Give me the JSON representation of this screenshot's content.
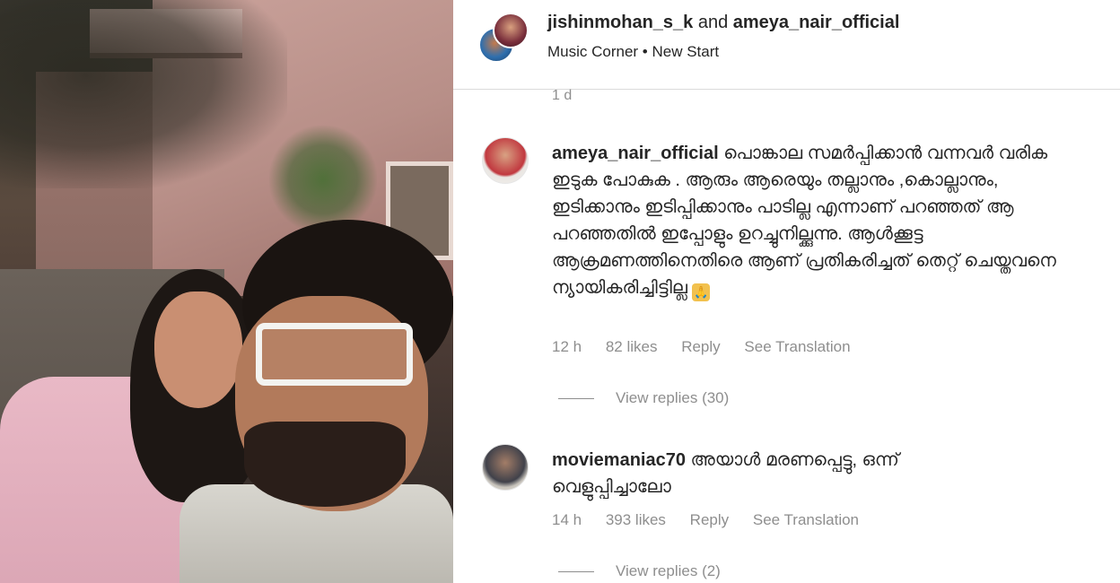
{
  "header": {
    "user1": "jishinmohan_s_k",
    "connector": " and ",
    "user2": "ameya_nair_official",
    "subtitle": "Music Corner • New Start"
  },
  "prev_time": "1 d",
  "comments": [
    {
      "username": "ameya_nair_official",
      "text": "പൊങ്കാല സമർപ്പിക്കാൻ വന്നവർ വരിക ഇടുക പോകുക . ആരും ആരെയും തല്ലാനും ,കൊല്ലാനും, ഇടിക്കാനും ഇടിപ്പിക്കാനും പാടില്ല എന്നാണ് പറഞ്ഞത് ആ പറഞ്ഞതിൽ ഇപ്പോളും ഉറച്ചുനില്ക്കുന്നു. ആൾക്കൂട്ട ആക്രമണത്തിനെതിരെ ആണ് പ്രതികരിച്ചത് തെറ്റ് ചെയ്തവനെ ന്യായികരിച്ചിട്ടില്ല",
      "emoji": "🙏",
      "time": "12 h",
      "likes": "82 likes",
      "reply": "Reply",
      "translate": "See Translation",
      "view_replies": "View replies (30)"
    },
    {
      "username": "moviemaniac70",
      "text": "അയാൾ മരണപ്പെട്ടു, ഒന്ന് വെളുപ്പിച്ചാലോ",
      "time": "14 h",
      "likes": "393 likes",
      "reply": "Reply",
      "translate": "See Translation",
      "view_replies": "View replies (2)"
    }
  ],
  "icons": {
    "header_avatar_1": "user-avatar-icon",
    "header_avatar_2": "user-avatar-icon",
    "comment_avatar": "user-avatar-icon",
    "reply_line": "divider-line-icon"
  }
}
